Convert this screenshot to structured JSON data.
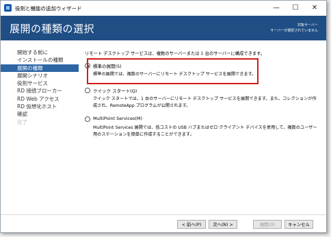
{
  "window": {
    "title": "役割と機能の追加ウィザード",
    "controls": {
      "minimize": "—",
      "maximize": "☐",
      "close": "✕"
    },
    "icon": "server-manager-icon"
  },
  "header": {
    "page_title": "展開の種類の選択",
    "target_server_line1": "対象サーバー",
    "target_server_line2": "サーバーが選択されていません",
    "bg_color": "#1f4e84"
  },
  "sidebar": {
    "items": [
      {
        "label": "開始する前に",
        "state": "normal"
      },
      {
        "label": "インストールの種類",
        "state": "normal"
      },
      {
        "label": "展開の種類",
        "state": "active"
      },
      {
        "label": "展開シナリオ",
        "state": "normal"
      },
      {
        "label": "役割サービス",
        "state": "normal"
      },
      {
        "label": "RD 接続ブローカー",
        "state": "normal"
      },
      {
        "label": "RD Web アクセス",
        "state": "normal"
      },
      {
        "label": "RD 仮想化ホスト",
        "state": "normal"
      },
      {
        "label": "確認",
        "state": "normal"
      },
      {
        "label": "完了",
        "state": "disabled"
      }
    ]
  },
  "main": {
    "intro": "リモート デスクトップ サービスは、複数のサーバーまたは 1 台のサーバーに構成できます。",
    "options": [
      {
        "label": "標準の展開(S)",
        "checked": true,
        "description": "標準の展開では、複数のサーバーにリモート デスクトップ サービスを展開できます。"
      },
      {
        "label": "クイック スタート(Q)",
        "checked": false,
        "description": "クイック スタートでは、1 台のサーバーにリモート デスクトップ サービスを展開できます。また、コレクションが作成され、RemoteApp プログラムが公開されます。"
      },
      {
        "label": "MultiPoint Services(M)",
        "checked": false,
        "description": "MultiPoint Services 展開では、低コストの USB ハブまたはゼロ クライアント デバイスを使用して、複数のユーザー用のステーションを簡単に作成することができます。"
      }
    ]
  },
  "buttons": {
    "prev": "< 前へ(P)",
    "next": "次へ(N) >",
    "install": "展開(D)",
    "cancel": "キャンセル"
  },
  "colors": {
    "highlight": "#d21a1a",
    "nav_active": "#2e66a4"
  }
}
